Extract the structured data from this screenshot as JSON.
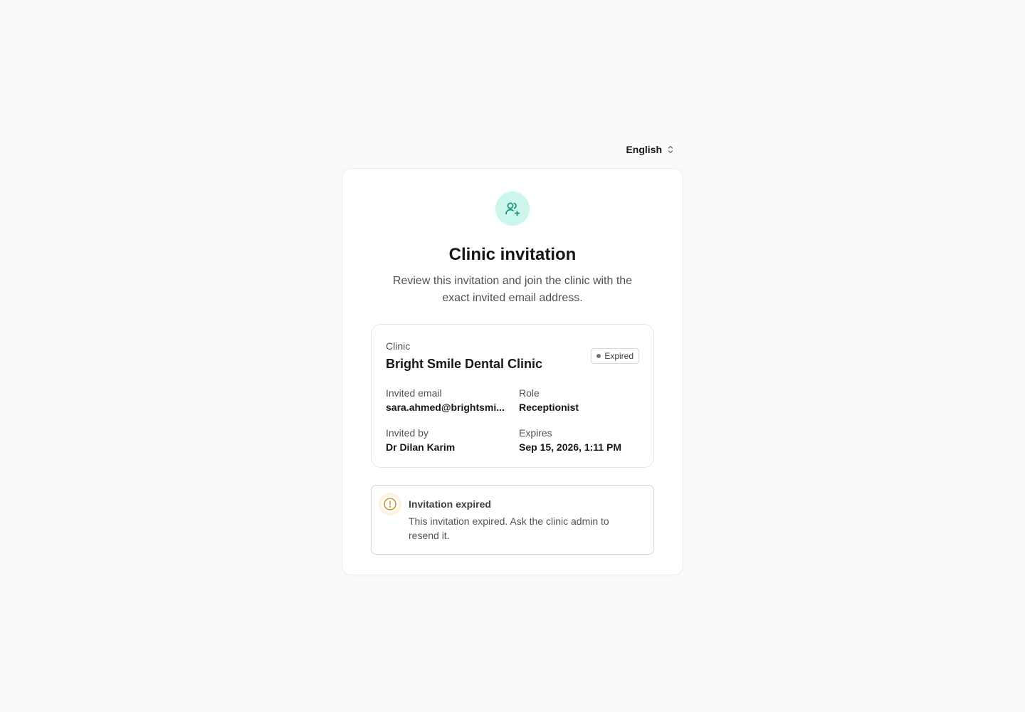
{
  "language": {
    "selected": "English"
  },
  "card": {
    "title": "Clinic invitation",
    "subtitle": "Review this invitation and join the clinic with the exact invited email address."
  },
  "details": {
    "clinic_label": "Clinic",
    "clinic_name": "Bright Smile Dental Clinic",
    "status_badge": "Expired",
    "invited_email_label": "Invited email",
    "invited_email_value": "sara.ahmed@brightsmi...",
    "role_label": "Role",
    "role_value": "Receptionist",
    "invited_by_label": "Invited by",
    "invited_by_value": "Dr Dilan Karim",
    "expires_label": "Expires",
    "expires_value": "Sep 15, 2026, 1:11 PM"
  },
  "alert": {
    "title": "Invitation expired",
    "body": "This invitation expired. Ask the clinic admin to resend it."
  },
  "colors": {
    "accent": "#0f8f7a",
    "accent_bg": "#ccf5ec",
    "warning": "#c9961a",
    "badge_dot": "#737373"
  },
  "icons": {
    "hero": "user-plus-icon",
    "language": "chevron-up-down-icon",
    "alert": "alert-circle-icon"
  }
}
